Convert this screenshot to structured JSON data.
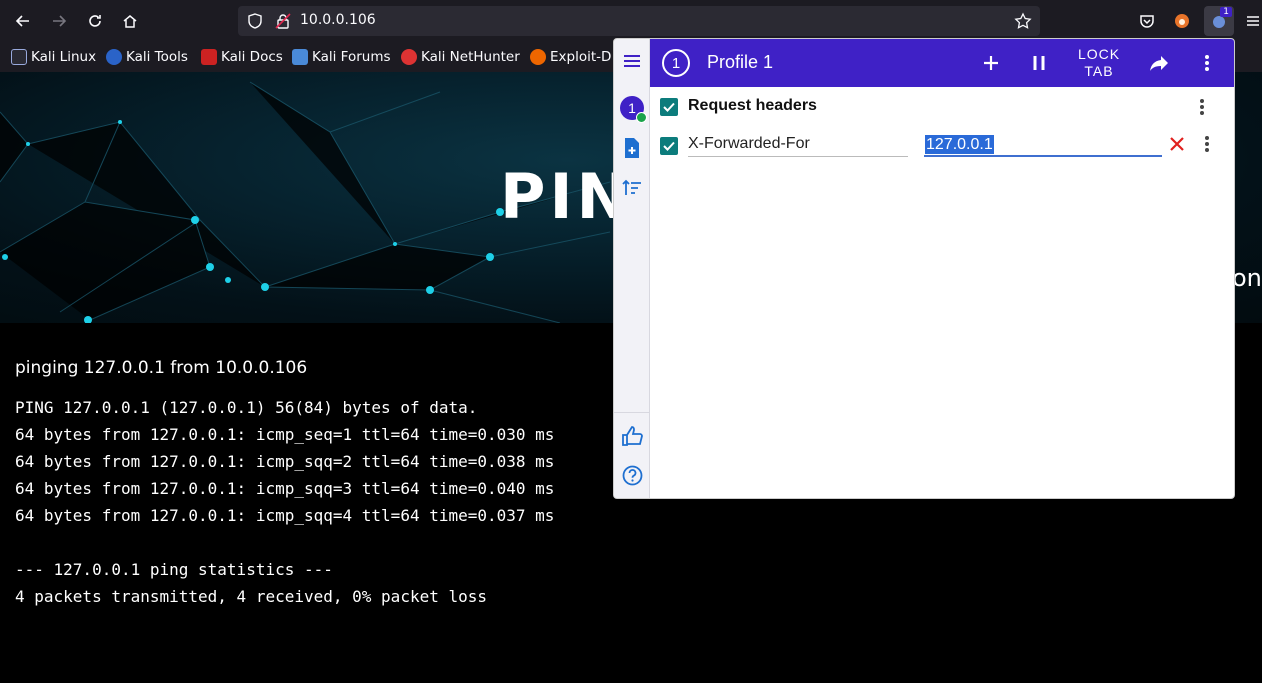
{
  "browser": {
    "url": "10.0.0.106",
    "bookmarks": [
      {
        "label": "Kali Linux",
        "color": "#9ad"
      },
      {
        "label": "Kali Tools",
        "color": "#c33"
      },
      {
        "label": "Kali Docs",
        "color": "#d22"
      },
      {
        "label": "Kali Forums",
        "color": "#48c"
      },
      {
        "label": "Kali NetHunter",
        "color": "#d33"
      },
      {
        "label": "Exploit-D",
        "color": "#e60"
      }
    ],
    "extension_badge": "1"
  },
  "page": {
    "hero_title": "PIN",
    "hero_side_text": "on",
    "ping_title": "pinging 127.0.0.1 from 10.0.0.106",
    "lines": [
      "PING 127.0.0.1 (127.0.0.1) 56(84) bytes of data.",
      "64 bytes from 127.0.0.1: icmp_seq=1 ttl=64 time=0.030 ms",
      "64 bytes from 127.0.0.1: icmp_sqq=2 ttl=64 time=0.038 ms",
      "64 bytes from 127.0.0.1: icmp_sqq=3 ttl=64 time=0.040 ms",
      "64 bytes from 127.0.0.1: icmp_sqq=4 ttl=64 time=0.037 ms",
      "",
      "--- 127.0.0.1 ping statistics ---",
      "4 packets transmitted, 4 received, 0% packet loss"
    ]
  },
  "modheader": {
    "profile_number": "1",
    "profile_title": "Profile 1",
    "lock_tab_line1": "LOCK",
    "lock_tab_line2": "TAB",
    "section_title": "Request headers",
    "header_name": "X-Forwarded-For",
    "header_value": "127.0.0.1",
    "accent_color": "#3f21c6",
    "checkbox_color": "#0c7c7c"
  }
}
